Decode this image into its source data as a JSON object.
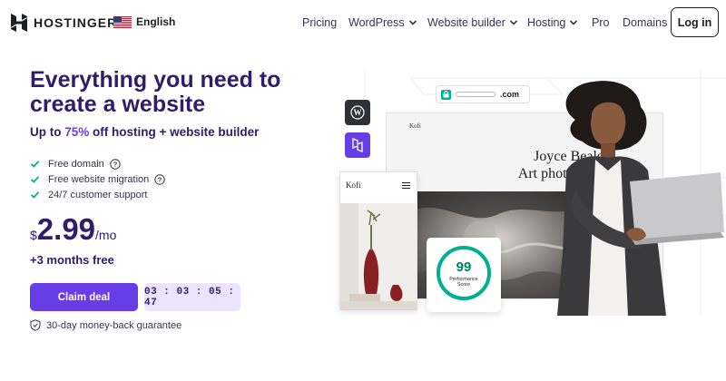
{
  "brand": {
    "name": "HOSTINGER"
  },
  "language": {
    "label": "English",
    "flag": "us-flag-icon"
  },
  "nav": {
    "items": [
      {
        "label": "Pricing",
        "dropdown": false
      },
      {
        "label": "WordPress",
        "dropdown": true
      },
      {
        "label": "Website builder",
        "dropdown": true
      },
      {
        "label": "Hosting",
        "dropdown": true
      },
      {
        "label": "Pro",
        "dropdown": false
      },
      {
        "label": "Domains",
        "dropdown": false
      }
    ],
    "login_label": "Log in"
  },
  "hero": {
    "title": "Everything you need to create a website",
    "subtitle_prefix": "Up to ",
    "subtitle_highlight": "75%",
    "subtitle_suffix": " off hosting + website builder",
    "features": [
      {
        "label": "Free domain",
        "help": true
      },
      {
        "label": "Free website migration",
        "help": true
      },
      {
        "label": "24/7 customer support",
        "help": false
      }
    ],
    "price": {
      "currency": "$",
      "amount": "2.99",
      "period": "/mo"
    },
    "bonus": "+3 months free",
    "cta_label": "Claim deal",
    "timer": "03 : 03 : 05 : 47",
    "guarantee": "30-day money-back guarantee"
  },
  "illustration": {
    "url_suffix": ".com",
    "site_name": "Kofi",
    "headline_line1": "Joyce Beale,",
    "headline_line2": "Art photograph",
    "score_value": "99",
    "score_label_line1": "Performance",
    "score_label_line2": "Score",
    "score_fraction": 0.99
  },
  "colors": {
    "primary": "#673de6",
    "heading": "#2f1c6a",
    "success": "#00b090",
    "timer_bg": "#ebe4ff"
  }
}
